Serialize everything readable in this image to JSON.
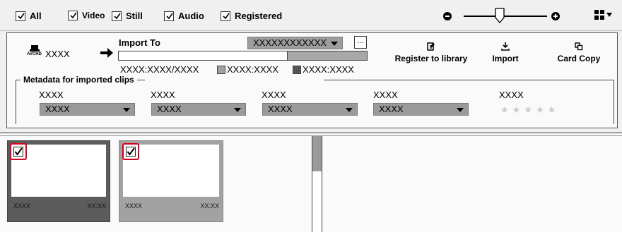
{
  "filters": {
    "all": "All",
    "video": "Video",
    "still": "Still",
    "audio": "Audio",
    "registered": "Registered"
  },
  "source": {
    "badge": "AVCHD",
    "name": "XXXX"
  },
  "import_to": {
    "label": "Import To",
    "destination": "XXXXXXXXXXXX",
    "browse": "...",
    "capacity_text": "XXXX:XXXX/XXXX",
    "legend1": "XXXX:XXXX",
    "legend2": "XXXX:XXXX",
    "used_fraction": 0.68
  },
  "actions": {
    "register": "Register to library",
    "import": "Import",
    "card_copy": "Card Copy"
  },
  "metadata": {
    "title": "Metadata for imported clips",
    "fields": [
      {
        "label": "XXXX",
        "value": "XXXX"
      },
      {
        "label": "XXXX",
        "value": "XXXX"
      },
      {
        "label": "XXXX",
        "value": "XXXX"
      },
      {
        "label": "XXXX",
        "value": "XXXX"
      }
    ],
    "rating_label": "XXXX",
    "rating_stars": 5
  },
  "clips": [
    {
      "name": "XXXX",
      "duration": "XX:XX"
    },
    {
      "name": "XXXX",
      "duration": "XX:XX"
    }
  ]
}
